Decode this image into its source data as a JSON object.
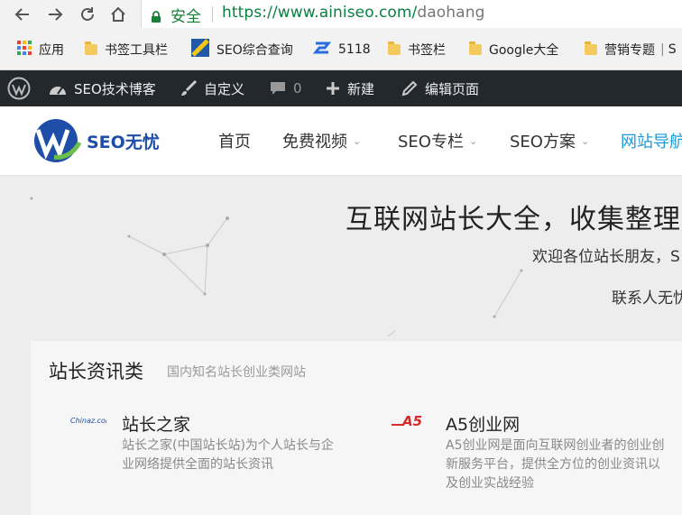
{
  "browser": {
    "secure_label": "安全",
    "url_host": "https://www.ainiseo.com/",
    "url_path": "daohang"
  },
  "bookmarks": [
    {
      "label": "应用",
      "icon": "apps-grid-icon"
    },
    {
      "label": "书签工具栏",
      "icon": "folder-icon"
    },
    {
      "label": "SEO综合查询",
      "icon": "seo-tool-icon"
    },
    {
      "label": "5118",
      "icon": "5118-logo-icon"
    },
    {
      "label": "书签栏",
      "icon": "folder-icon"
    },
    {
      "label": "Google大全",
      "icon": "folder-icon"
    },
    {
      "label": "营销专题",
      "icon": "folder-icon"
    },
    {
      "label": "S",
      "icon": "folder-icon"
    }
  ],
  "adminbar": {
    "site_name": "SEO技术博客",
    "customize": "自定义",
    "comments_count": "0",
    "new_label": "新建",
    "edit_page": "编辑页面"
  },
  "header": {
    "logo_text": "SEO无忧",
    "nav": [
      {
        "label": "首页"
      },
      {
        "label": "免费视频"
      },
      {
        "label": "SEO专栏"
      },
      {
        "label": "SEO方案"
      },
      {
        "label": "网站导航"
      }
    ]
  },
  "hero": {
    "title": "互联网站长大全，收集整理站",
    "subtitle": "欢迎各位站长朋友，S",
    "contact": "联系人无忧"
  },
  "section": {
    "title": "站长资讯类",
    "subtitle": "国内知名站长创业类网站",
    "sites": [
      {
        "name": "站长之家",
        "logo_text": "Chinaz.com",
        "desc_line1": "站长之家(中国站长站)为个人站长与企",
        "desc_line2": "业网络提供全面的站长资讯",
        "desc_line3": ""
      },
      {
        "name": "A5创业网",
        "logo_text": "A5",
        "desc_line1": "A5创业网是面向互联网创业者的创业创",
        "desc_line2": "新服务平台，提供全方位的创业资讯以",
        "desc_line3": "及创业实战经验"
      }
    ]
  },
  "colors": {
    "secure_green": "#188038",
    "admin_bar": "#23282d",
    "active_nav": "#1a9ad6",
    "logo_blue": "#1e4ea8"
  }
}
